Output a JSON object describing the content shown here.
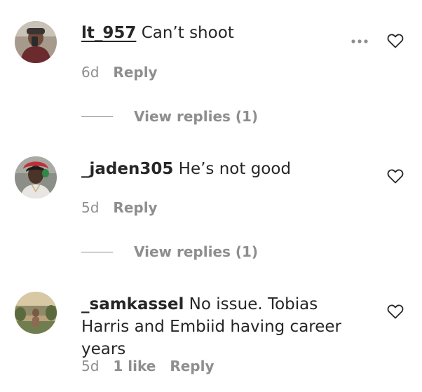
{
  "comments": [
    {
      "username": "lt_957",
      "text": "Can’t shoot",
      "time": "6d",
      "likes": "",
      "reply_label": "Reply",
      "view_replies": "View replies (1)"
    },
    {
      "username": "_jaden305",
      "text": "He’s not good",
      "time": "5d",
      "likes": "",
      "reply_label": "Reply",
      "view_replies": "View replies (1)"
    },
    {
      "username": "_samkassel",
      "text": "No issue. Tobias Harris and Embiid having career years",
      "time": "5d",
      "likes": "1 like",
      "reply_label": "Reply",
      "view_replies": ""
    }
  ],
  "icons": {
    "heart": "heart-outline-icon",
    "more": "more-options-icon"
  },
  "colors": {
    "text": "#262626",
    "muted": "#8e8e8e",
    "background": "#ffffff"
  }
}
